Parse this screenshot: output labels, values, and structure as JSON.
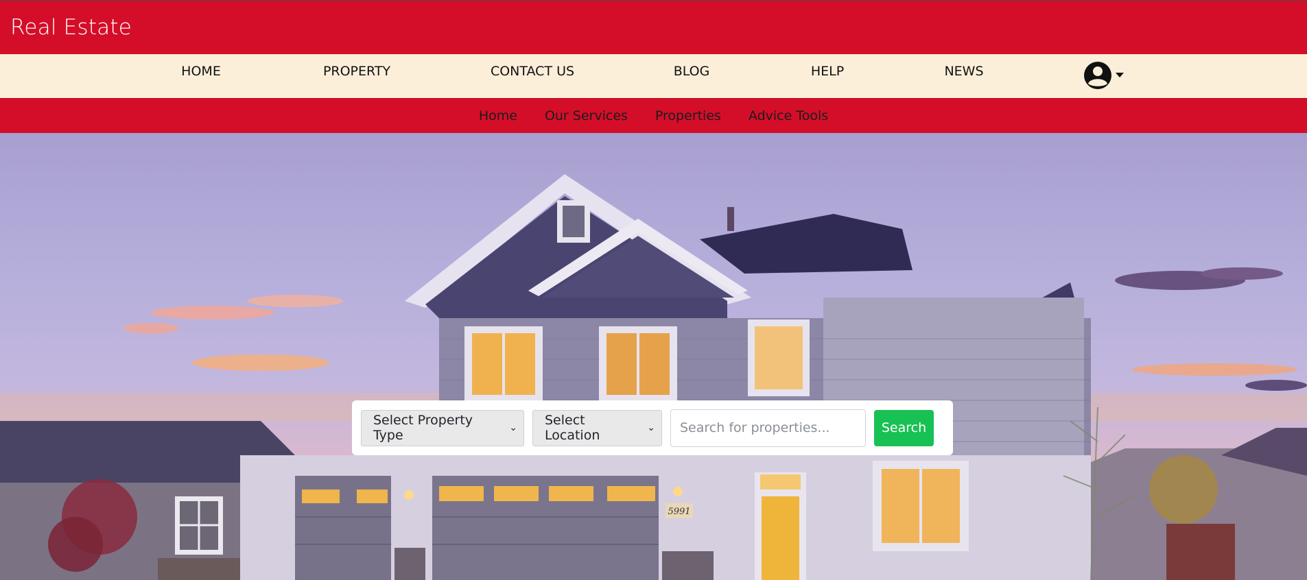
{
  "brand": {
    "title": "Real Estate"
  },
  "main_nav": {
    "items": [
      {
        "label": "HOME"
      },
      {
        "label": "PROPERTY"
      },
      {
        "label": "CONTACT US"
      },
      {
        "label": "BLOG"
      },
      {
        "label": "HELP"
      },
      {
        "label": "NEWS"
      }
    ],
    "user_icon": "user-circle-icon",
    "dropdown_icon": "caret-down-icon"
  },
  "sub_nav": {
    "items": [
      {
        "label": "Home"
      },
      {
        "label": "Our Services"
      },
      {
        "label": "Properties"
      },
      {
        "label": "Advice Tools"
      }
    ]
  },
  "hero": {
    "house_number": "5991"
  },
  "search": {
    "property_type_selected": "Select Property Type",
    "location_selected": "Select Location",
    "query_placeholder": "Search for properties...",
    "query_value": "",
    "button_label": "Search"
  },
  "colors": {
    "brand_red": "#d40e29",
    "nav_bg": "#fcefd9",
    "search_green": "#17c153"
  }
}
